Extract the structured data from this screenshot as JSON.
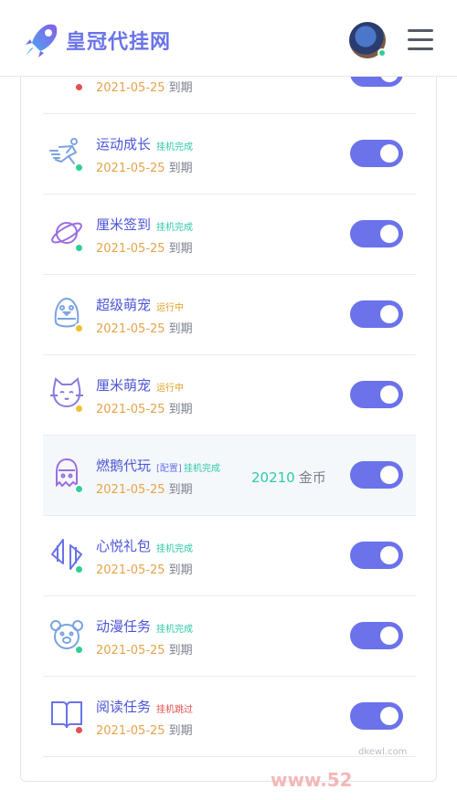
{
  "brand": {
    "name": "皇冠代挂网"
  },
  "colors": {
    "accent": "#6b72ea",
    "status_done": "#30cf9a",
    "status_running": "#f0c030",
    "status_skip": "#e35050",
    "date": "#e7a24a"
  },
  "rows": [
    {
      "name": "",
      "tag": "",
      "date": "2021-05-25",
      "expires": "到期",
      "status": "skip",
      "icon": "diamond-icon",
      "enabled": true
    },
    {
      "name": "运动成长",
      "tag": "挂机完成",
      "date": "2021-05-25",
      "expires": "到期",
      "status": "done",
      "icon": "runner-icon",
      "enabled": true
    },
    {
      "name": "厘米签到",
      "tag": "挂机完成",
      "date": "2021-05-25",
      "expires": "到期",
      "status": "done",
      "icon": "planet-icon",
      "enabled": true
    },
    {
      "name": "超级萌宠",
      "tag": "运行中",
      "date": "2021-05-25",
      "expires": "到期",
      "status": "running",
      "icon": "penguin-icon",
      "enabled": true
    },
    {
      "name": "厘米萌宠",
      "tag": "运行中",
      "date": "2021-05-25",
      "expires": "到期",
      "status": "running",
      "icon": "cat-icon",
      "enabled": true
    },
    {
      "name": "燃鹅代玩",
      "config": "[配置]",
      "tag": "挂机完成",
      "date": "2021-05-25",
      "expires": "到期",
      "status": "done",
      "icon": "ghost-icon",
      "coins": "20210",
      "coins_unit": "金币",
      "enabled": true
    },
    {
      "name": "心悦礼包",
      "tag": "挂机完成",
      "date": "2021-05-25",
      "expires": "到期",
      "status": "done",
      "icon": "arrows-icon",
      "enabled": true
    },
    {
      "name": "动漫任务",
      "tag": "挂机完成",
      "date": "2021-05-25",
      "expires": "到期",
      "status": "done",
      "icon": "bear-icon",
      "enabled": true
    },
    {
      "name": "阅读任务",
      "tag": "挂机跳过",
      "date": "2021-05-25",
      "expires": "到期",
      "status": "skip",
      "icon": "book-icon",
      "enabled": true
    }
  ],
  "watermark": {
    "text": "www.52",
    "sub": "dkewl.com"
  }
}
